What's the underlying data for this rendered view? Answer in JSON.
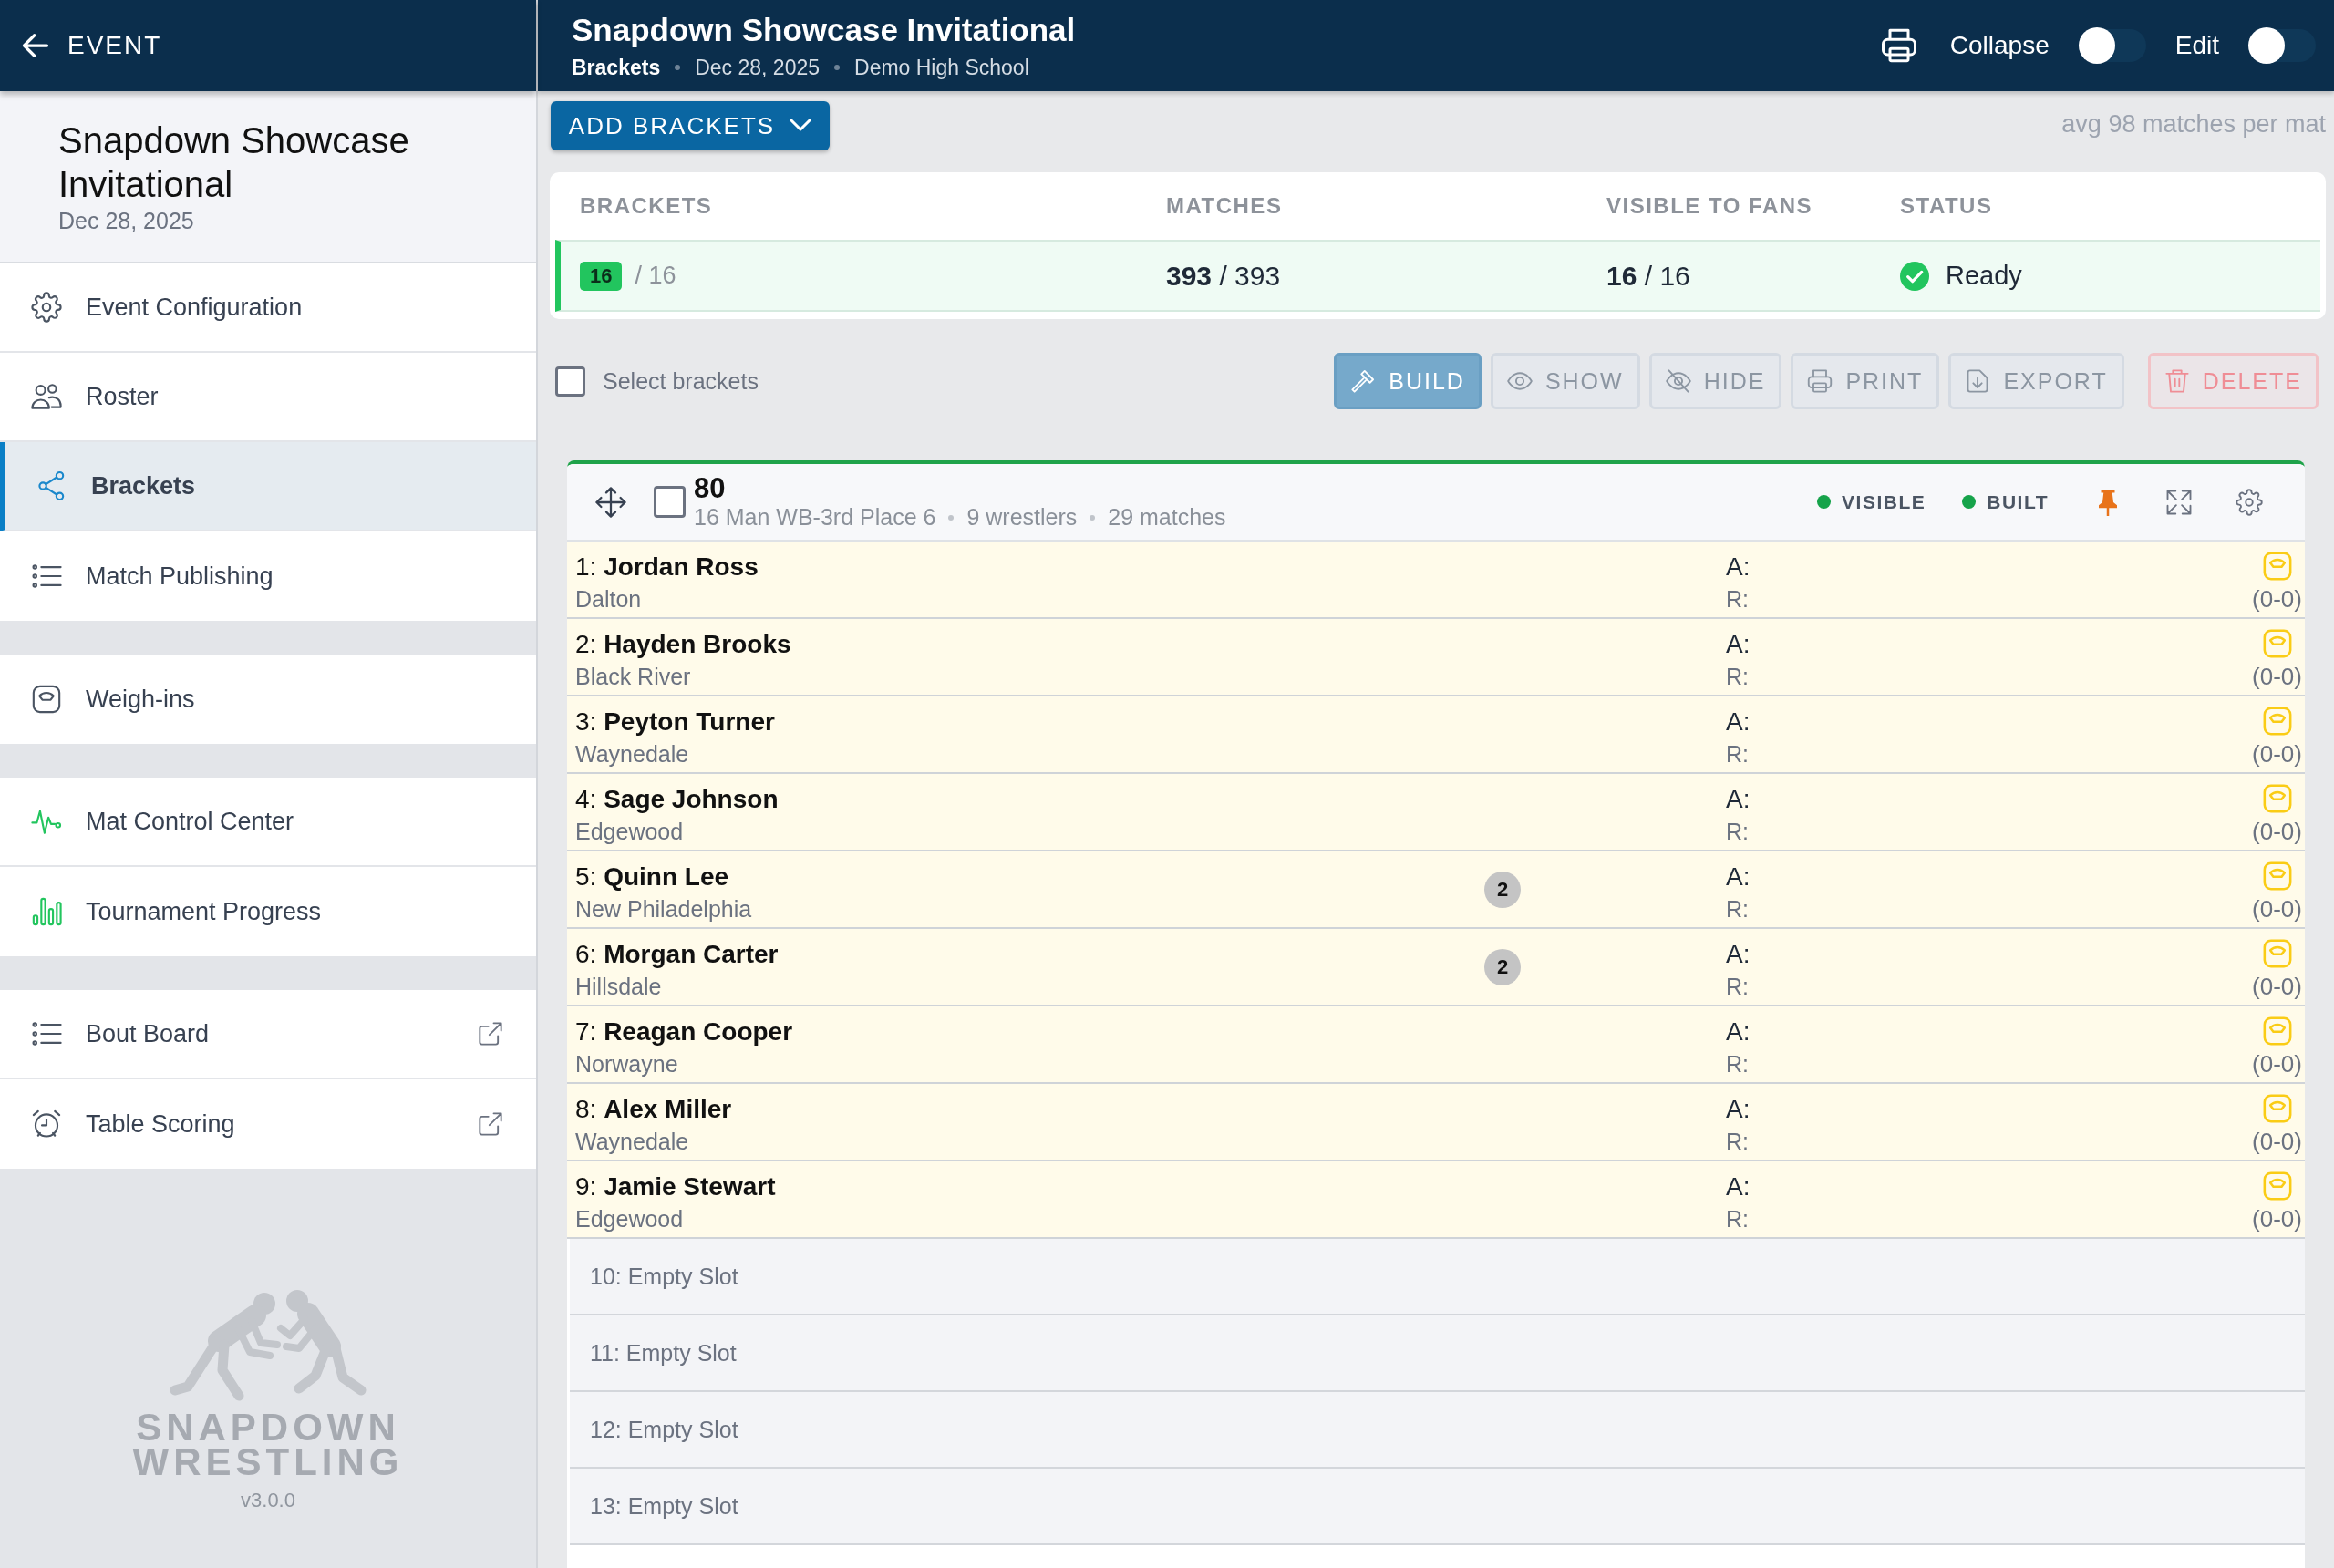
{
  "sidebar": {
    "back": "EVENT",
    "event": {
      "title": "Snapdown Showcase Invitational",
      "date": "Dec 28, 2025"
    },
    "groups": [
      {
        "items": [
          {
            "label": "Event Configuration",
            "selected": false,
            "external": false
          },
          {
            "label": "Roster",
            "selected": false,
            "external": false
          },
          {
            "label": "Brackets",
            "selected": true,
            "external": false
          },
          {
            "label": "Match Publishing",
            "selected": false,
            "external": false
          }
        ]
      },
      {
        "items": [
          {
            "label": "Weigh-ins",
            "selected": false,
            "external": false
          }
        ]
      },
      {
        "items": [
          {
            "label": "Mat Control Center",
            "selected": false,
            "external": false
          },
          {
            "label": "Tournament Progress",
            "selected": false,
            "external": false
          }
        ]
      },
      {
        "items": [
          {
            "label": "Bout Board",
            "selected": false,
            "external": true
          },
          {
            "label": "Table Scoring",
            "selected": false,
            "external": true
          }
        ]
      }
    ],
    "logo": {
      "line_1": "SNAPDOWN",
      "line_2": "WRESTLING",
      "version": "v3.0.0"
    }
  },
  "header": {
    "title": "Snapdown Showcase Invitational",
    "breadcrumb": [
      "Brackets",
      "Dec 28, 2025",
      "Demo High School"
    ],
    "toggles": [
      {
        "label": "Collapse",
        "on": false
      },
      {
        "label": "Edit",
        "on": false
      }
    ]
  },
  "toolbar": {
    "add_button": "ADD BRACKETS",
    "average": "avg 98 matches per mat"
  },
  "summary": {
    "columns": [
      "BRACKETS",
      "MATCHES",
      "VISIBLE TO FANS",
      "STATUS"
    ],
    "brackets_count": "16",
    "brackets_total": "/ 16",
    "matches": "**393** / 393",
    "visible": "**16** / 16",
    "status": "Ready"
  },
  "actions": {
    "select_all": {
      "label": "Select brackets",
      "checked": false
    },
    "buttons": [
      {
        "label": "BUILD",
        "kind": "primary"
      },
      {
        "label": "SHOW",
        "kind": "outline"
      },
      {
        "label": "HIDE",
        "kind": "outline"
      },
      {
        "label": "PRINT",
        "kind": "outline"
      },
      {
        "label": "EXPORT",
        "kind": "outline"
      },
      {
        "label": "DELETE",
        "kind": "danger"
      }
    ]
  },
  "bracket": {
    "title": "80",
    "checked": false,
    "meta": [
      "16 Man WB-3rd Place 6",
      "9 wrestlers",
      "29 matches"
    ],
    "flags": [
      {
        "label": "VISIBLE",
        "on": true
      },
      {
        "label": "BUILT",
        "on": true
      }
    ],
    "pinned": true,
    "wrestlers": [
      {
        "label": "1: **Jordan Ross**",
        "team": "Dalton",
        "a": "A:",
        "r": "R:",
        "record": "(0-0)"
      },
      {
        "label": "2: **Hayden Brooks**",
        "team": "Black River",
        "a": "A:",
        "r": "R:",
        "record": "(0-0)"
      },
      {
        "label": "3: **Peyton Turner**",
        "team": "Waynedale",
        "a": "A:",
        "r": "R:",
        "record": "(0-0)"
      },
      {
        "label": "4: **Sage Johnson**",
        "team": "Edgewood",
        "a": "A:",
        "r": "R:",
        "record": "(0-0)"
      },
      {
        "label": "5: **Quinn Lee**",
        "team": "New Philadelphia",
        "badge": "2",
        "a": "A:",
        "r": "R:",
        "record": "(0-0)"
      },
      {
        "label": "6: **Morgan Carter**",
        "team": "Hillsdale",
        "badge": "2",
        "a": "A:",
        "r": "R:",
        "record": "(0-0)"
      },
      {
        "label": "7: **Reagan Cooper**",
        "team": "Norwayne",
        "a": "A:",
        "r": "R:",
        "record": "(0-0)"
      },
      {
        "label": "8: **Alex Miller**",
        "team": "Waynedale",
        "a": "A:",
        "r": "R:",
        "record": "(0-0)"
      },
      {
        "label": "9: **Jamie Stewart**",
        "team": "Edgewood",
        "a": "A:",
        "r": "R:",
        "record": "(0-0)"
      }
    ],
    "empty_slots": [
      "10: Empty Slot",
      "11: Empty Slot",
      "12: Empty Slot",
      "13: Empty Slot"
    ]
  }
}
